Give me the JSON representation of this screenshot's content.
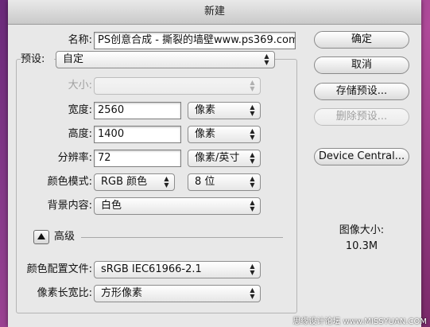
{
  "window": {
    "title": "新建"
  },
  "name": {
    "label": "名称:",
    "value": "PS创意合成 - 撕裂的墙壁www.ps369.com"
  },
  "preset": {
    "label": "预设:",
    "value": "自定"
  },
  "size": {
    "label": "大小:",
    "value": ""
  },
  "width": {
    "label": "宽度:",
    "value": "2560",
    "unit": "像素"
  },
  "height": {
    "label": "高度:",
    "value": "1400",
    "unit": "像素"
  },
  "resolution": {
    "label": "分辨率:",
    "value": "72",
    "unit": "像素/英寸"
  },
  "color_mode": {
    "label": "颜色模式:",
    "value": "RGB 颜色",
    "depth": "8 位"
  },
  "background": {
    "label": "背景内容:",
    "value": "白色"
  },
  "advanced": {
    "label": "高级"
  },
  "color_profile": {
    "label": "颜色配置文件:",
    "value": "sRGB IEC61966-2.1"
  },
  "pixel_aspect": {
    "label": "像素长宽比:",
    "value": "方形像素"
  },
  "buttons": {
    "ok": "确定",
    "cancel": "取消",
    "save_preset": "存储预设...",
    "delete_preset": "删除预设...",
    "device_central": "Device Central..."
  },
  "image_size": {
    "label": "图像大小:",
    "value": "10.3M"
  },
  "watermark": "思缘设计论坛 www.MISSYUAN.COM"
}
